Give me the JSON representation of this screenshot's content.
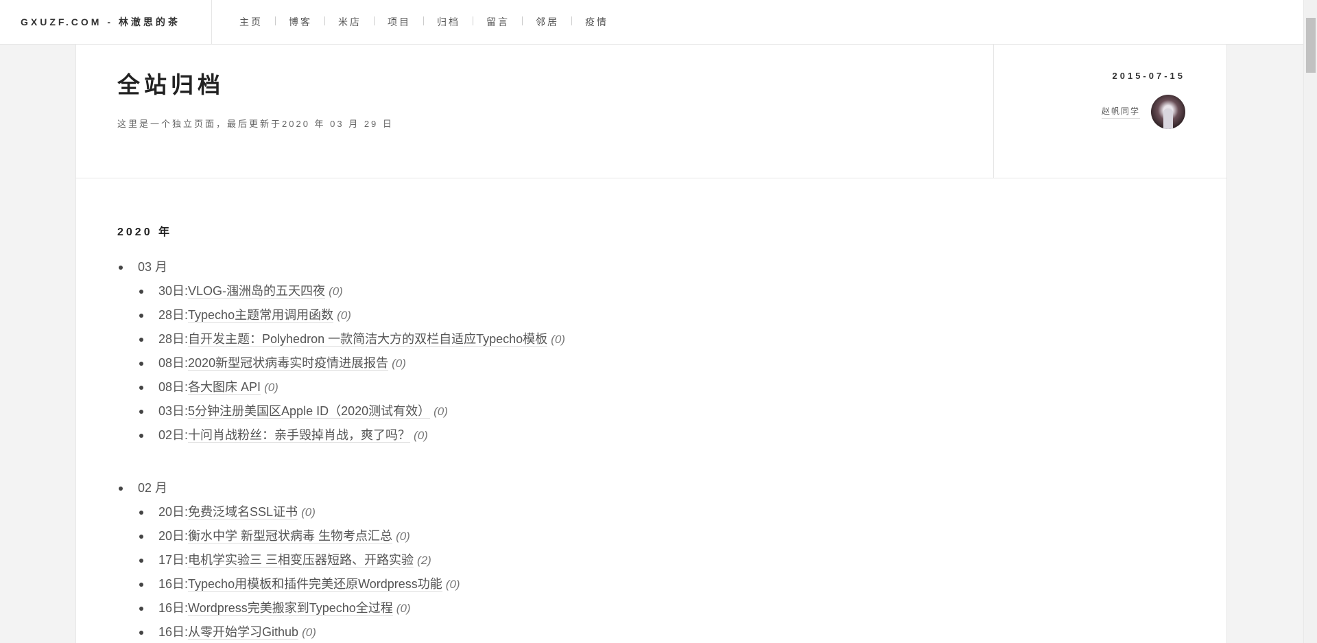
{
  "site": {
    "title": "GXUZF.COM - 林澈思的茶"
  },
  "nav": [
    "主页",
    "博客",
    "米店",
    "项目",
    "归档",
    "留言",
    "邻居",
    "疫情"
  ],
  "page": {
    "title": "全站归档",
    "desc": "这里是一个独立页面，最后更新于2020 年 03 月 29 日",
    "date": "2015-07-15",
    "author": "赵帆同学"
  },
  "archive": {
    "year": "2020 年",
    "months": [
      {
        "label": "03 月",
        "posts": [
          {
            "day": "30日:",
            "title": "VLOG-涠洲岛的五天四夜",
            "count": "(0)"
          },
          {
            "day": "28日:",
            "title": "Typecho主题常用调用函数",
            "count": "(0)"
          },
          {
            "day": "28日:",
            "title": "自开发主题：Polyhedron 一款简洁大方的双栏自适应Typecho模板",
            "count": "(0)"
          },
          {
            "day": "08日:",
            "title": "2020新型冠状病毒实时疫情进展报告",
            "count": "(0)"
          },
          {
            "day": "08日:",
            "title": "各大图床 API",
            "count": "(0)"
          },
          {
            "day": "03日:",
            "title": "5分钟注册美国区Apple ID（2020测试有效）",
            "count": "(0)"
          },
          {
            "day": "02日:",
            "title": "十问肖战粉丝：亲手毁掉肖战，爽了吗？",
            "count": "(0)"
          }
        ]
      },
      {
        "label": "02 月",
        "posts": [
          {
            "day": "20日:",
            "title": "免费泛域名SSL证书",
            "count": "(0)"
          },
          {
            "day": "20日:",
            "title": "衡水中学 新型冠状病毒 生物考点汇总",
            "count": "(0)"
          },
          {
            "day": "17日:",
            "title": "电机学实验三 三相变压器短路、开路实验",
            "count": "(2)"
          },
          {
            "day": "16日:",
            "title": "Typecho用模板和插件完美还原Wordpress功能",
            "count": "(0)"
          },
          {
            "day": "16日:",
            "title": "Wordpress完美搬家到Typecho全过程",
            "count": "(0)"
          },
          {
            "day": "16日:",
            "title": "从零开始学习Github",
            "count": "(0)"
          }
        ]
      }
    ]
  }
}
